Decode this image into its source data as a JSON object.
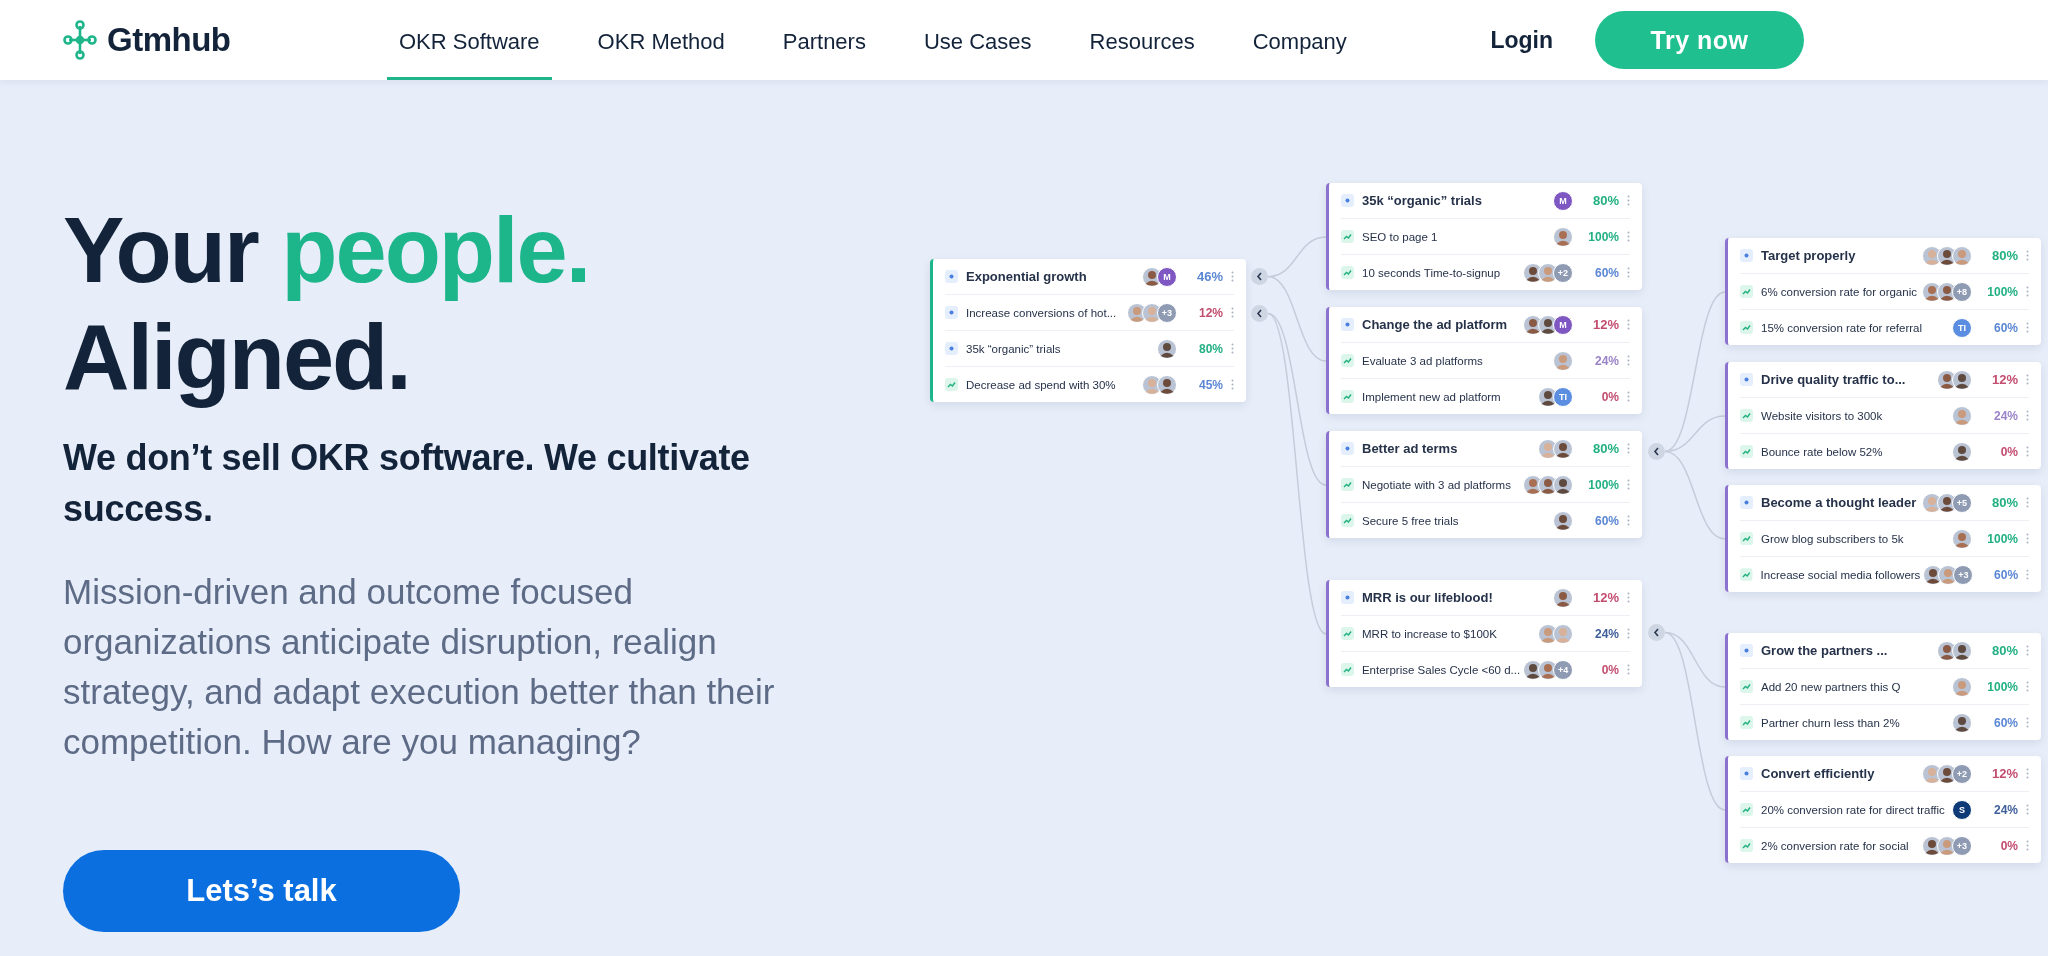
{
  "header": {
    "logo": "Gtmhub",
    "nav": [
      {
        "label": "OKR Software",
        "selected": true
      },
      {
        "label": "OKR Method",
        "selected": false
      },
      {
        "label": "Partners",
        "selected": false
      },
      {
        "label": "Use Cases",
        "selected": false
      },
      {
        "label": "Resources",
        "selected": false
      },
      {
        "label": "Company",
        "selected": false
      }
    ],
    "login": "Login",
    "cta": "Try now"
  },
  "hero": {
    "headline_1": "Your",
    "headline_highlight": "people.",
    "headline_2": "Aligned.",
    "subheading": "We don’t sell OKR software. We cultivate success.",
    "description": "Mission-driven and outcome focused organizations anticipate disruption, realign strategy, and adapt execution better than their competition. How are you managing?",
    "button": "Lets’s talk"
  },
  "okr_map": {
    "cards": [
      {
        "color": "#1db58a",
        "rows": [
          {
            "kind": "objective",
            "title": "Exponential growth",
            "avatars": [
              {
                "kind": "photo"
              },
              {
                "kind": "initials",
                "text": "M",
                "color": "#7e57c2"
              }
            ],
            "percent": "46%",
            "color": "#5b87d4"
          },
          {
            "kind": "objective",
            "title": "Increase conversions of hot...",
            "avatars": [
              {
                "kind": "photo"
              },
              {
                "kind": "photo"
              },
              {
                "kind": "count",
                "text": "+3"
              }
            ],
            "percent": "12%",
            "color": "#c34d6e"
          },
          {
            "kind": "objective",
            "title": "35k “organic” trials",
            "avatars": [
              {
                "kind": "photo"
              }
            ],
            "percent": "80%",
            "color": "#22b082"
          },
          {
            "kind": "key_result",
            "title": "Decrease ad spend with 30%",
            "avatars": [
              {
                "kind": "photo"
              },
              {
                "kind": "photo"
              }
            ],
            "percent": "45%",
            "color": "#5b87d4"
          }
        ]
      },
      {
        "color": "#8c72cf",
        "rows": [
          {
            "kind": "objective",
            "title": "35k “organic” trials",
            "avatars": [
              {
                "kind": "initials",
                "text": "M",
                "color": "#7e57c2"
              }
            ],
            "percent": "80%",
            "color": "#22b082"
          },
          {
            "kind": "key_result",
            "title": "SEO to page 1",
            "avatars": [
              {
                "kind": "photo"
              }
            ],
            "percent": "100%",
            "color": "#22b082"
          },
          {
            "kind": "key_result",
            "title": "10 seconds Time-to-signup",
            "avatars": [
              {
                "kind": "photo"
              },
              {
                "kind": "photo"
              },
              {
                "kind": "count",
                "text": "+2"
              }
            ],
            "percent": "60%",
            "color": "#5b87d4"
          }
        ]
      },
      {
        "color": "#8c72cf",
        "rows": [
          {
            "kind": "objective",
            "title": "Change the ad platform",
            "avatars": [
              {
                "kind": "photo"
              },
              {
                "kind": "photo"
              },
              {
                "kind": "initials",
                "text": "M",
                "color": "#7e57c2"
              }
            ],
            "percent": "12%",
            "color": "#c34d6e"
          },
          {
            "kind": "key_result",
            "title": "Evaluate 3 ad platforms",
            "avatars": [
              {
                "kind": "photo"
              }
            ],
            "percent": "24%",
            "color": "#9a84c8"
          },
          {
            "kind": "key_result",
            "title": "Implement new ad platform",
            "avatars": [
              {
                "kind": "photo"
              },
              {
                "kind": "initials",
                "text": "TI",
                "color": "#5b8de0"
              }
            ],
            "percent": "0%",
            "color": "#c34d6e"
          }
        ]
      },
      {
        "color": "#8c72cf",
        "rows": [
          {
            "kind": "objective",
            "title": "Better ad terms",
            "avatars": [
              {
                "kind": "photo"
              },
              {
                "kind": "photo"
              }
            ],
            "percent": "80%",
            "color": "#22b082"
          },
          {
            "kind": "key_result",
            "title": "Negotiate with 3 ad platforms",
            "avatars": [
              {
                "kind": "photo"
              },
              {
                "kind": "photo"
              },
              {
                "kind": "photo"
              }
            ],
            "percent": "100%",
            "color": "#22b082"
          },
          {
            "kind": "key_result",
            "title": "Secure 5 free trials",
            "avatars": [
              {
                "kind": "photo"
              }
            ],
            "percent": "60%",
            "color": "#5b87d4"
          }
        ]
      },
      {
        "color": "#8c72cf",
        "rows": [
          {
            "kind": "objective",
            "title": "MRR is our lifeblood!",
            "avatars": [
              {
                "kind": "photo"
              }
            ],
            "percent": "12%",
            "color": "#c34d6e"
          },
          {
            "kind": "key_result",
            "title": "MRR to increase to $100K",
            "avatars": [
              {
                "kind": "photo"
              },
              {
                "kind": "photo"
              }
            ],
            "percent": "24%",
            "color": "#3f5f9a"
          },
          {
            "kind": "key_result",
            "title": "Enterprise Sales Cycle <60 d...",
            "avatars": [
              {
                "kind": "photo"
              },
              {
                "kind": "photo"
              },
              {
                "kind": "count",
                "text": "+4"
              }
            ],
            "percent": "0%",
            "color": "#c34d6e"
          }
        ]
      },
      {
        "color": "#8c72cf",
        "rows": [
          {
            "kind": "objective",
            "title": "Target properly",
            "avatars": [
              {
                "kind": "photo"
              },
              {
                "kind": "photo"
              },
              {
                "kind": "photo"
              }
            ],
            "percent": "80%",
            "color": "#22b082"
          },
          {
            "kind": "key_result",
            "title": "6% conversion rate for organic",
            "avatars": [
              {
                "kind": "photo"
              },
              {
                "kind": "photo"
              },
              {
                "kind": "count",
                "text": "+8"
              }
            ],
            "percent": "100%",
            "color": "#22b082"
          },
          {
            "kind": "key_result",
            "title": "15% conversion rate for referral",
            "avatars": [
              {
                "kind": "initials",
                "text": "TI",
                "color": "#5b8de0"
              }
            ],
            "percent": "60%",
            "color": "#5b87d4"
          }
        ]
      },
      {
        "color": "#8c72cf",
        "rows": [
          {
            "kind": "objective",
            "title": "Drive quality traffic to...",
            "avatars": [
              {
                "kind": "photo"
              },
              {
                "kind": "photo"
              }
            ],
            "percent": "12%",
            "color": "#c34d6e"
          },
          {
            "kind": "key_result",
            "title": "Website visitors to 300k",
            "avatars": [
              {
                "kind": "photo"
              }
            ],
            "percent": "24%",
            "color": "#9a84c8"
          },
          {
            "kind": "key_result",
            "title": "Bounce rate below 52%",
            "avatars": [
              {
                "kind": "photo"
              }
            ],
            "percent": "0%",
            "color": "#c34d6e"
          }
        ]
      },
      {
        "color": "#8c72cf",
        "rows": [
          {
            "kind": "objective",
            "title": "Become a thought leader",
            "avatars": [
              {
                "kind": "photo"
              },
              {
                "kind": "photo"
              },
              {
                "kind": "count",
                "text": "+5"
              }
            ],
            "percent": "80%",
            "color": "#22b082"
          },
          {
            "kind": "key_result",
            "title": "Grow blog subscribers to 5k",
            "avatars": [
              {
                "kind": "photo"
              }
            ],
            "percent": "100%",
            "color": "#22b082"
          },
          {
            "kind": "key_result",
            "title": "Increase social media followers",
            "avatars": [
              {
                "kind": "photo"
              },
              {
                "kind": "photo"
              },
              {
                "kind": "count",
                "text": "+3"
              }
            ],
            "percent": "60%",
            "color": "#5b87d4"
          }
        ]
      },
      {
        "color": "#8c72cf",
        "rows": [
          {
            "kind": "objective",
            "title": "Grow the partners ...",
            "avatars": [
              {
                "kind": "photo"
              },
              {
                "kind": "photo"
              }
            ],
            "percent": "80%",
            "color": "#22b082"
          },
          {
            "kind": "key_result",
            "title": "Add 20 new partners this Q",
            "avatars": [
              {
                "kind": "photo"
              }
            ],
            "percent": "100%",
            "color": "#22b082"
          },
          {
            "kind": "key_result",
            "title": "Partner churn less than 2%",
            "avatars": [
              {
                "kind": "photo"
              }
            ],
            "percent": "60%",
            "color": "#5b87d4"
          }
        ]
      },
      {
        "color": "#8c72cf",
        "rows": [
          {
            "kind": "objective",
            "title": "Convert efficiently",
            "avatars": [
              {
                "kind": "photo"
              },
              {
                "kind": "photo"
              },
              {
                "kind": "count",
                "text": "+2"
              }
            ],
            "percent": "12%",
            "color": "#c34d6e"
          },
          {
            "kind": "key_result",
            "title": "20% conversion rate for direct traffic",
            "avatars": [
              {
                "kind": "initials",
                "text": "S",
                "color": "#0e3a78"
              }
            ],
            "percent": "24%",
            "color": "#3f5f9a"
          },
          {
            "kind": "key_result",
            "title": "2% conversion rate for social",
            "avatars": [
              {
                "kind": "photo"
              },
              {
                "kind": "photo"
              },
              {
                "kind": "count",
                "text": "+3"
              }
            ],
            "percent": "0%",
            "color": "#c34d6e"
          }
        ]
      }
    ]
  }
}
